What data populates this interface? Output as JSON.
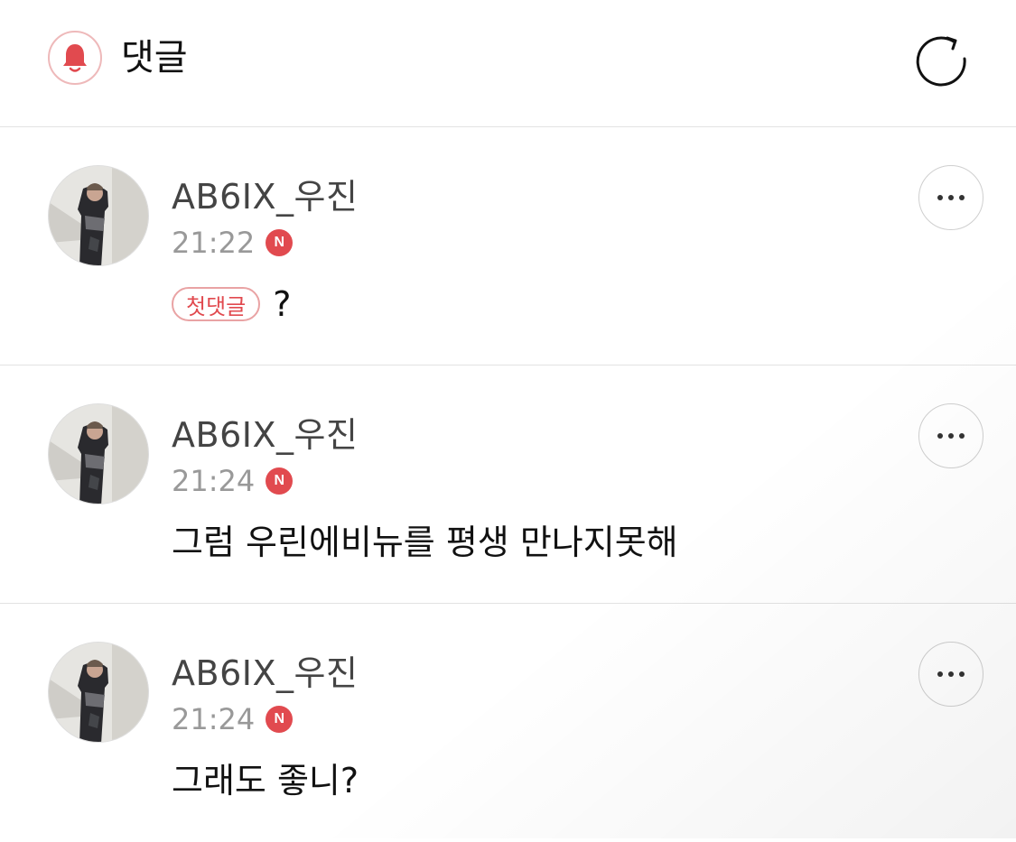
{
  "header": {
    "title": "댓글",
    "bell_icon": "bell-icon",
    "refresh_icon": "refresh-icon",
    "accent": "#e14a4f"
  },
  "comments": [
    {
      "author": "AB6IX_우진",
      "time": "21:22",
      "new_badge": "N",
      "first_badge": "첫댓글",
      "text": "?"
    },
    {
      "author": "AB6IX_우진",
      "time": "21:24",
      "new_badge": "N",
      "first_badge": "",
      "text": "그럼 우린에비뉴를 평생 만나지못해"
    },
    {
      "author": "AB6IX_우진",
      "time": "21:24",
      "new_badge": "N",
      "first_badge": "",
      "text": "그래도 좋니?"
    }
  ]
}
